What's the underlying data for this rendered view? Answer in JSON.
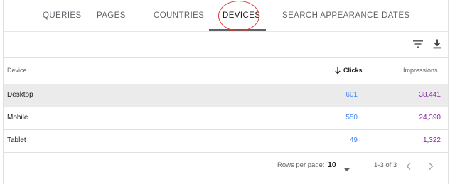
{
  "tabs": [
    {
      "label": "QUERIES"
    },
    {
      "label": "PAGES"
    },
    {
      "label": "COUNTRIES"
    },
    {
      "label": "DEVICES"
    },
    {
      "label": "SEARCH APPEARANCE"
    },
    {
      "label": "DATES"
    }
  ],
  "active_tab": "DEVICES",
  "toolbar": {
    "filter_icon": "filter-icon",
    "download_icon": "download-icon"
  },
  "table": {
    "headers": {
      "device": "Device",
      "clicks": "Clicks",
      "impressions": "Impressions"
    },
    "sort_icon": "arrow-down-icon",
    "rows": [
      {
        "device": "Desktop",
        "clicks": "601",
        "impressions": "38,441"
      },
      {
        "device": "Mobile",
        "clicks": "550",
        "impressions": "24,390"
      },
      {
        "device": "Tablet",
        "clicks": "49",
        "impressions": "1,322"
      }
    ]
  },
  "pagination": {
    "rows_per_page_label": "Rows per page:",
    "rows_per_page_value": "10",
    "range": "1-3 of 3"
  },
  "colors": {
    "clicks": "#4285f4",
    "impressions": "#8e24aa",
    "annotation_circle": "#e53935"
  }
}
